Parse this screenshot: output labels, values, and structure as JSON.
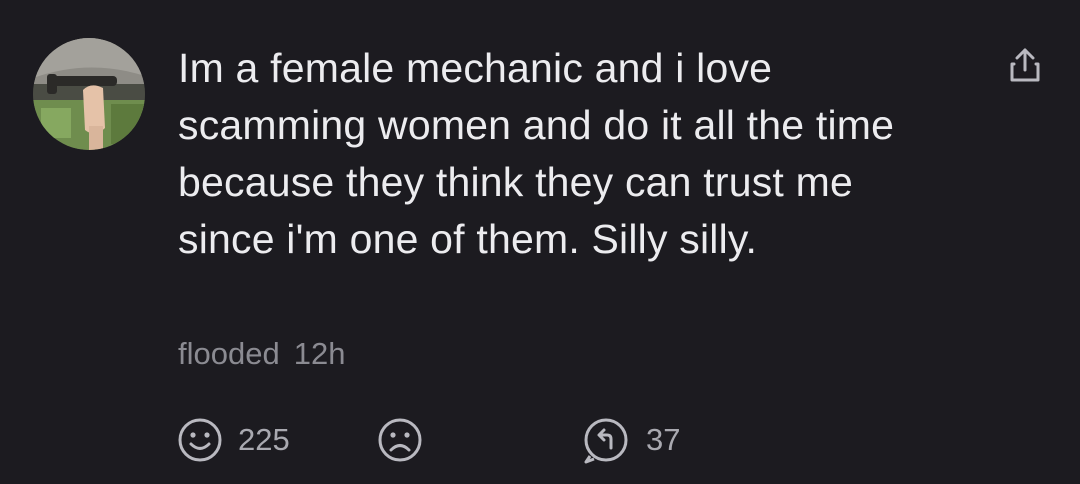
{
  "comment": {
    "text": "Im a female mechanic and i love scamming women and do it all the time because they think they can trust me since i'm one of them. Silly silly.",
    "author": "flooded",
    "time": "12h",
    "likes": "225",
    "replies": "37"
  },
  "icons": {
    "share": "share-up-arrow-icon",
    "like": "smiley-face-icon",
    "dislike": "sad-face-icon",
    "reply": "reply-arrow-circle-icon"
  },
  "colors": {
    "background": "#1c1b20",
    "text": "#ececef",
    "muted": "#8b8b92"
  }
}
